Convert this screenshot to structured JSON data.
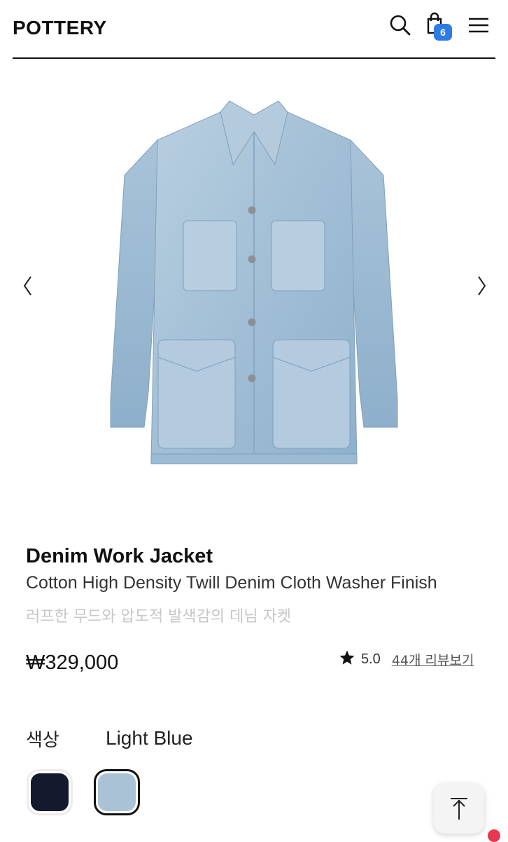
{
  "header": {
    "logo": "POTTERY",
    "cart_count": "6"
  },
  "product": {
    "name": "Denim Work Jacket",
    "subtitle": "Cotton High Density Twill Denim Cloth Washer Finish",
    "description": "러프한 무드와 압도적 발색감의 데님 자켓",
    "price": "₩329,000",
    "rating": "5.0",
    "reviews_link": "44개 리뷰보기"
  },
  "options": {
    "color_label": "색상",
    "selected_color": "Light Blue",
    "swatches": [
      {
        "name": "navy",
        "color": "#14192e"
      },
      {
        "name": "light-blue",
        "color": "#a9c2d6"
      }
    ]
  },
  "colors": {
    "badge": "#2f7be6",
    "denim": "#a9c4da",
    "notification": "#e8384f"
  },
  "icons": [
    "search-icon",
    "shopping-bag-icon",
    "menu-icon",
    "chevron-left-icon",
    "chevron-right-icon",
    "star-icon",
    "arrow-up-icon"
  ]
}
